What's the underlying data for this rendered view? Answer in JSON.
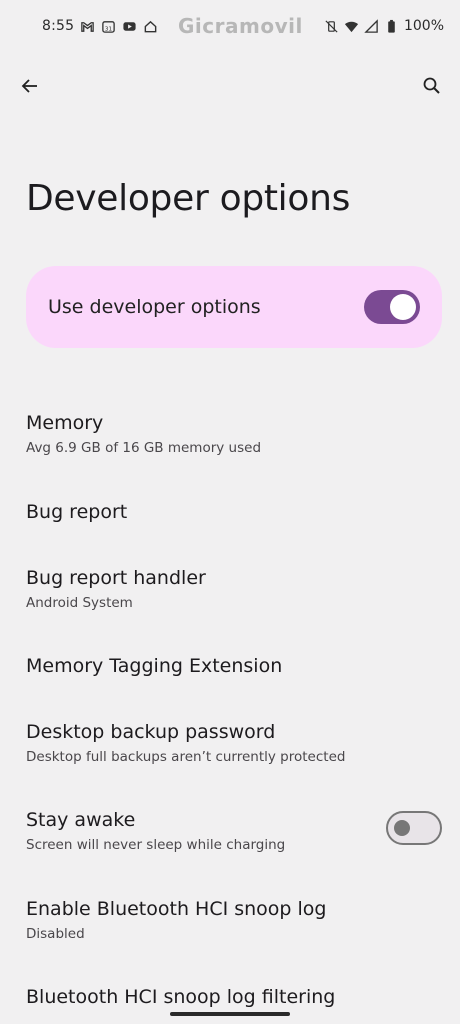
{
  "status_bar": {
    "time": "8:55",
    "watermark": "Gicramovil",
    "battery": "100%"
  },
  "app_bar": {
    "back_icon": "arrow-back-icon",
    "search_icon": "search-icon"
  },
  "page": {
    "title": "Developer options"
  },
  "master": {
    "label": "Use developer options",
    "enabled": true
  },
  "items": [
    {
      "title": "Memory",
      "summary": "Avg 6.9 GB of 16 GB memory used"
    },
    {
      "title": "Bug report",
      "summary": ""
    },
    {
      "title": "Bug report handler",
      "summary": "Android System"
    },
    {
      "title": "Memory Tagging Extension",
      "summary": ""
    },
    {
      "title": "Desktop backup password",
      "summary": "Desktop full backups aren’t currently protected"
    },
    {
      "title": "Stay awake",
      "summary": "Screen will never sleep while charging",
      "toggle": false
    },
    {
      "title": "Enable Bluetooth HCI snoop log",
      "summary": "Disabled"
    },
    {
      "title": "Bluetooth HCI snoop log filtering",
      "summary": ""
    }
  ],
  "colors": {
    "card_bg": "#fbd7fb",
    "switch_on": "#7b4a93",
    "background": "#f1f0f1"
  }
}
